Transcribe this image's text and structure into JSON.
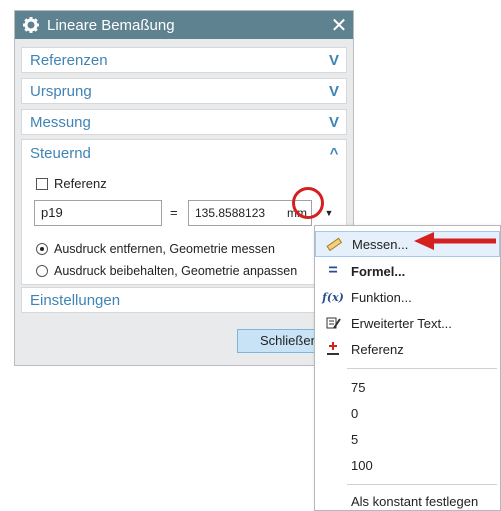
{
  "dialog": {
    "title": "Lineare Bemaßung",
    "close_glyph": "✕",
    "sections": [
      {
        "label": "Referenzen",
        "chevron": "V"
      },
      {
        "label": "Ursprung",
        "chevron": "V"
      },
      {
        "label": "Messung",
        "chevron": "V"
      }
    ],
    "steuernd": {
      "label": "Steuernd",
      "chevron": "^",
      "checkbox_label": "Referenz",
      "param_name": "p19",
      "equals": "=",
      "param_value": "135.8588123",
      "unit": "mm",
      "dropdown_glyph": "▼",
      "radio_options": [
        {
          "label": "Ausdruck entfernen, Geometrie messen",
          "selected": true
        },
        {
          "label": "Ausdruck beibehalten, Geometrie anpassen",
          "selected": false
        }
      ]
    },
    "einstellungen": {
      "label": "Einstellungen"
    },
    "close_button": "Schließen"
  },
  "menu": {
    "items": [
      {
        "label": "Messen...",
        "icon": "ruler-icon",
        "selected": true
      },
      {
        "label": "Formel...",
        "icon": "equals-icon",
        "bold": true
      },
      {
        "label": "Funktion...",
        "icon": "function-icon",
        "icon_text": "f(x)"
      },
      {
        "label": "Erweiterter Text...",
        "icon": "edit-text-icon"
      },
      {
        "label": "Referenz",
        "icon": "reference-icon"
      }
    ],
    "values": [
      "75",
      "0",
      "5",
      "100"
    ],
    "footer": "Als konstant festlegen"
  },
  "colors": {
    "titlebar": "#5f8290",
    "section_text": "#3f84b5",
    "highlight": "#d52020",
    "menu_selected": "#e5f0fb"
  }
}
